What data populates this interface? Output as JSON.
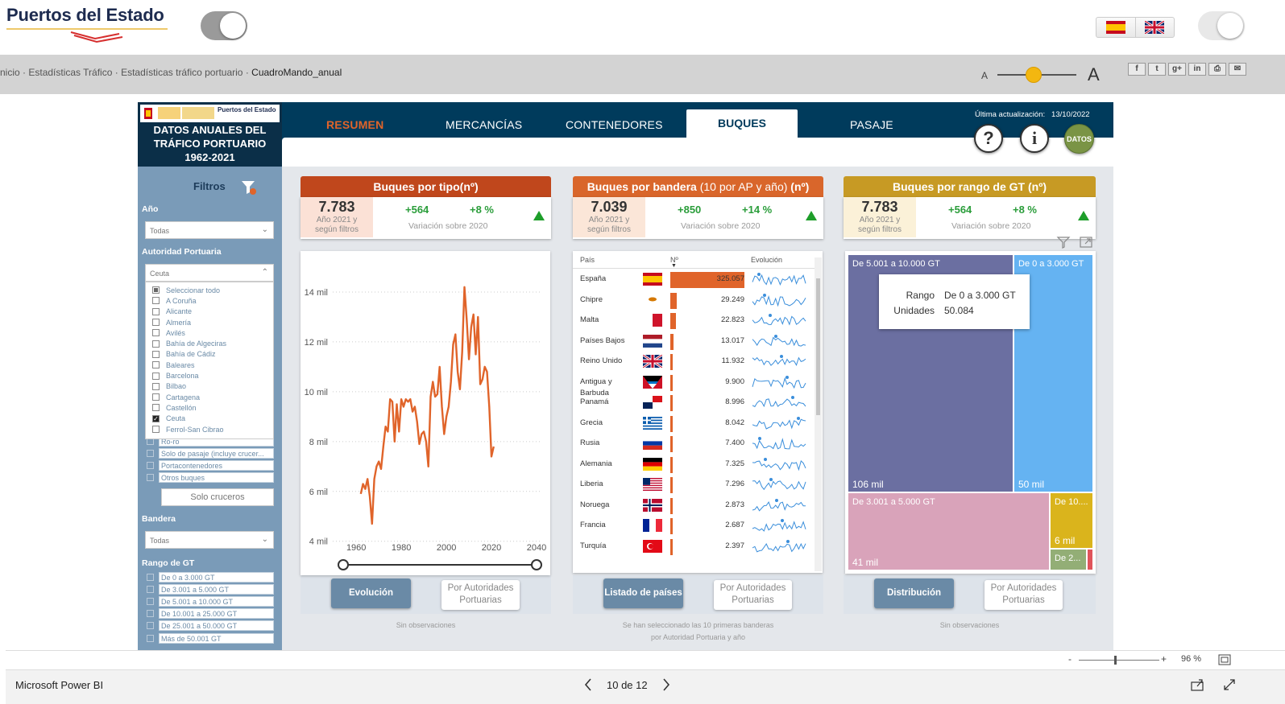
{
  "site": {
    "logo": "Puertos del Estado",
    "breadcrumb": [
      "nicio",
      "Estadísticas Tráfico",
      "Estadísticas tráfico portuario",
      "CuadroMando_anual"
    ],
    "font_small": "A",
    "font_large": "A",
    "share_labels": [
      "f",
      "t",
      "g+",
      "in",
      "⎙",
      "✉"
    ]
  },
  "dashboard": {
    "brand_logo_text": "Puertos del Estado",
    "title_lines": [
      "DATOS ANUALES DEL",
      "TRÁFICO PORTUARIO",
      "1962-2021"
    ],
    "tabs": [
      "RESUMEN",
      "MERCANCÍAS",
      "CONTENEDORES",
      "BUQUES",
      "PASAJE"
    ],
    "active_tab": "BUQUES",
    "update_label": "Última actualización:",
    "update_date": "13/10/2022",
    "help_label": "?",
    "info_label": "i",
    "datos_label": "DATOS"
  },
  "filters": {
    "title": "Filtros",
    "year_label": "Año",
    "year_value": "Todas",
    "ap_label": "Autoridad Portuaria",
    "ap_value": "Ceuta",
    "ap_options": [
      "Seleccionar todo",
      "A Coruña",
      "Alicante",
      "Almería",
      "Avilés",
      "Bahía de Algeciras",
      "Bahía de Cádiz",
      "Baleares",
      "Barcelona",
      "Bilbao",
      "Cartagena",
      "Castellón",
      "Ceuta",
      "Ferrol-San Cibrao"
    ],
    "ap_checked": "Ceuta",
    "type_options": [
      "Ro-ro",
      "Solo de pasaje (incluye crucer...",
      "Portacontenedores",
      "Otros buques"
    ],
    "cruise_button": "Solo cruceros",
    "flag_label": "Bandera",
    "flag_value": "Todas",
    "gt_label": "Rango de GT",
    "gt_options": [
      "De 0 a 3.000 GT",
      "De 3.001 a 5.000 GT",
      "De 5.001 a 10.000 GT",
      "De 10.001 a 25.000 GT",
      "De 25.001 a 50.000 GT",
      "Más de 50.001 GT"
    ]
  },
  "cards": [
    {
      "title": "Buques por tipo",
      "title_light": "",
      "title_unit": "(nº)",
      "color": "#c0471c",
      "kpi": "7.783",
      "kpi_sub": [
        "Año 2021 y",
        "según filtros"
      ],
      "kpi_bg": "#fbe1d6",
      "delta_abs": "+564",
      "delta_pct": "+8 %",
      "delta_label": "Variación sobre 2020",
      "btn_primary": "Evolución",
      "btn_secondary": [
        "Por Autoridades",
        "Portuarias"
      ],
      "note": [
        "Sin observaciones"
      ]
    },
    {
      "title": "Buques por bandera",
      "title_light": " (10 por AP y año)",
      "title_unit": " (nº)",
      "color": "#d9662b",
      "kpi": "7.039",
      "kpi_sub": [
        "Año 2021 y",
        "según filtros"
      ],
      "kpi_bg": "#fbe6d8",
      "delta_abs": "+850",
      "delta_pct": "+14 %",
      "delta_label": "Variación sobre 2020",
      "btn_primary": "Listado de países",
      "btn_secondary": [
        "Por Autoridades",
        "Portuarias"
      ],
      "note": [
        "Se han seleccionado las 10 primeras banderas",
        "por Autoridad Portuaria y año"
      ]
    },
    {
      "title": "Buques por rango de GT",
      "title_light": "",
      "title_unit": " (nº)",
      "color": "#c79a24",
      "kpi": "7.783",
      "kpi_sub": [
        "Año 2021 y",
        "según filtros"
      ],
      "kpi_bg": "#fbf1d8",
      "delta_abs": "+564",
      "delta_pct": "+8 %",
      "delta_label": "Variación sobre 2020",
      "btn_primary": "Distribución",
      "btn_secondary": [
        "Por Autoridades",
        "Portuarias"
      ],
      "note": [
        "Sin observaciones"
      ]
    }
  ],
  "chart_data": [
    {
      "type": "line",
      "color": "#e0642a",
      "x": [
        1962,
        1963,
        1964,
        1965,
        1966,
        1967,
        1968,
        1969,
        1970,
        1971,
        1972,
        1973,
        1974,
        1975,
        1976,
        1977,
        1978,
        1979,
        1980,
        1981,
        1982,
        1983,
        1984,
        1985,
        1986,
        1987,
        1988,
        1989,
        1990,
        1991,
        1992,
        1993,
        1994,
        1995,
        1996,
        1997,
        1998,
        1999,
        2000,
        2001,
        2002,
        2003,
        2004,
        2005,
        2006,
        2007,
        2008,
        2009,
        2010,
        2011,
        2012,
        2013,
        2014,
        2015,
        2016,
        2017,
        2018,
        2019,
        2020,
        2021
      ],
      "y": [
        5900,
        6300,
        6100,
        6500,
        5800,
        4700,
        6500,
        7000,
        7200,
        6900,
        7800,
        8600,
        8400,
        9700,
        9600,
        8000,
        9500,
        8400,
        9700,
        9400,
        9700,
        9600,
        9700,
        9200,
        9400,
        8800,
        7900,
        8300,
        8400,
        8000,
        7000,
        9800,
        10400,
        9800,
        9900,
        11000,
        9400,
        8300,
        9000,
        9400,
        10400,
        11900,
        12300,
        10800,
        10100,
        11600,
        14200,
        12900,
        11300,
        12600,
        13100,
        11500,
        13000,
        10300,
        10500,
        11000,
        10800,
        9400,
        7400,
        7800
      ],
      "xlim": [
        1956,
        2040
      ],
      "ylim": [
        3700,
        15000
      ],
      "xticks": [
        1960,
        1980,
        2000,
        2020,
        2040
      ],
      "yticks": [
        4000,
        6000,
        8000,
        10000,
        12000,
        14000
      ],
      "ytick_labels": [
        "4 mil",
        "6 mil",
        "8 mil",
        "10 mil",
        "12 mil",
        "14 mil"
      ]
    },
    {
      "type": "table",
      "columns": [
        "País",
        "Nº",
        "Evolución"
      ],
      "rows": [
        {
          "pais": "España",
          "n": 325057,
          "label": "325.057",
          "flag": "es"
        },
        {
          "pais": "Chipre",
          "n": 29249,
          "label": "29.249",
          "flag": "cy"
        },
        {
          "pais": "Malta",
          "n": 22823,
          "label": "22.823",
          "flag": "mt"
        },
        {
          "pais": "Países Bajos",
          "n": 13017,
          "label": "13.017",
          "flag": "nl"
        },
        {
          "pais": "Reino Unido",
          "n": 11932,
          "label": "11.932",
          "flag": "gb"
        },
        {
          "pais": "Antigua y Barbuda",
          "n": 9900,
          "label": "9.900",
          "flag": "ag"
        },
        {
          "pais": "Panamá",
          "n": 8996,
          "label": "8.996",
          "flag": "pa"
        },
        {
          "pais": "Grecia",
          "n": 8042,
          "label": "8.042",
          "flag": "gr"
        },
        {
          "pais": "Rusia",
          "n": 7400,
          "label": "7.400",
          "flag": "ru"
        },
        {
          "pais": "Alemania",
          "n": 7325,
          "label": "7.325",
          "flag": "de"
        },
        {
          "pais": "Liberia",
          "n": 7296,
          "label": "7.296",
          "flag": "lr"
        },
        {
          "pais": "Noruega",
          "n": 2873,
          "label": "2.873",
          "flag": "no"
        },
        {
          "pais": "Francia",
          "n": 2687,
          "label": "2.687",
          "flag": "fr"
        },
        {
          "pais": "Turquía",
          "n": 2397,
          "label": "2.397",
          "flag": "tr"
        }
      ]
    },
    {
      "type": "treemap",
      "cells": [
        {
          "label": "De 5.001 a 10.000 GT",
          "value_label": "106 mil",
          "color": "#6b6fa1"
        },
        {
          "label": "De 0 a 3.000 GT",
          "value_label": "50 mil",
          "color": "#65b3f2"
        },
        {
          "label": "De 3.001 a 5.000 GT",
          "value_label": "41 mil",
          "color": "#d9a3ba"
        },
        {
          "label": "De 10....",
          "value_label": "6 mil",
          "color": "#dab41c"
        },
        {
          "label": "De 2...",
          "value_label": "",
          "color": "#93ae76"
        },
        {
          "label": "",
          "value_label": "",
          "color": "#e0545b"
        }
      ],
      "tooltip": {
        "k1": "Rango",
        "v1": "De 0 a 3.000 GT",
        "k2": "Unidades",
        "v2": "50.084"
      }
    }
  ],
  "footer": {
    "zoom_minus": "-",
    "zoom_plus": "+",
    "zoom_level": "96 %",
    "app_name": "Microsoft Power BI",
    "page_indicator": "10 de 12"
  }
}
